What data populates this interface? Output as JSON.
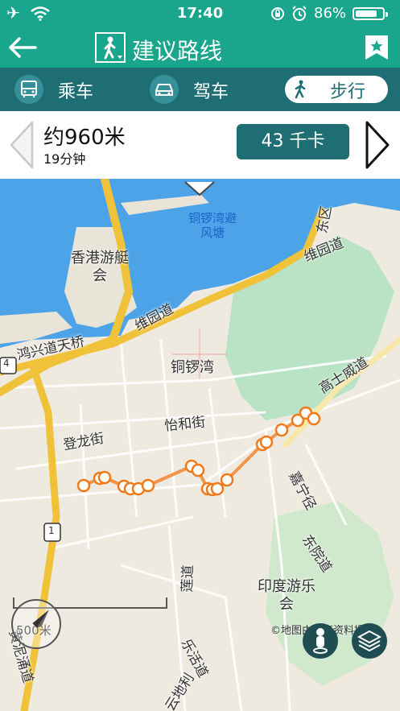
{
  "status_bar": {
    "time": "17:40",
    "battery": "86%",
    "battery_level": 0.86
  },
  "title_bar": {
    "title": "建议路线"
  },
  "modes": [
    {
      "label": "乘车",
      "icon": "bus-icon"
    },
    {
      "label": "驾车",
      "icon": "car-icon"
    },
    {
      "label": "步行",
      "icon": "walking-icon",
      "selected": true
    }
  ],
  "summary": {
    "distance": "约960米",
    "duration": "19分钟",
    "calories": "43 千卡"
  },
  "map": {
    "labels": {
      "causeway_typhoon_shelter": "铜锣湾避\n风塘",
      "yacht_club": "香港游艇\n会",
      "victoria_park_road_w": "维园道",
      "victoria_park_road_e": "维园道",
      "hung_hing_road_bridge": "鸿兴道天桥",
      "causeway_bay": "铜锣湾",
      "yee_wo_street": "怡和街",
      "tang_lung_street": "登龙街",
      "causeway_road": "高士威道",
      "tung_lo_wan_road": "东区",
      "ka_ning_path": "嘉宁径",
      "tung_yuen_road": "东院道",
      "indian_recreation_club": "印度游乐\n会",
      "lin_fa_road": "莲道",
      "lok_wo_road": "乐活道",
      "yun_ping": "云地利",
      "wong_nai_chung": "黄泥涌道",
      "highway_1": "1",
      "highway_4": "4"
    },
    "scale": "500米",
    "copyright": "©地图由政府资料提供"
  }
}
